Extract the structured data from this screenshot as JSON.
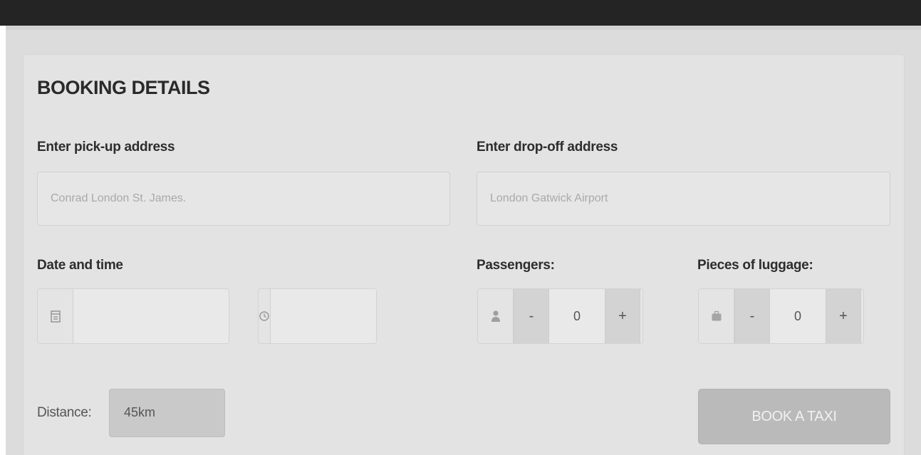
{
  "booking": {
    "title": "BOOKING DETAILS",
    "pickup": {
      "label": "Enter pick-up address",
      "placeholder": "Conrad London St. James."
    },
    "dropoff": {
      "label": "Enter drop-off address",
      "placeholder": "London Gatwick Airport"
    },
    "datetime": {
      "label": "Date and time",
      "date_icon": "calendar-icon",
      "time_icon": "clock-icon",
      "date_value": "",
      "time_value": ""
    },
    "passengers": {
      "label": "Passengers:",
      "icon": "user-icon",
      "minus": "-",
      "value": "0",
      "plus": "+"
    },
    "luggage": {
      "label": "Pieces of luggage:",
      "icon": "suitcase-icon",
      "minus": "-",
      "value": "0",
      "plus": "+"
    },
    "distance": {
      "label": "Distance:",
      "value": "45km"
    },
    "book_button": "BOOK A TAXI"
  }
}
